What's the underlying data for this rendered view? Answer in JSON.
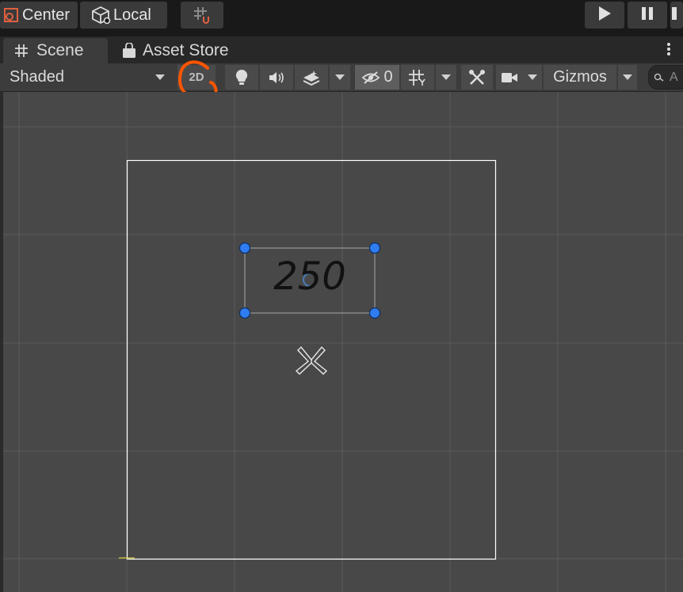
{
  "toolbar": {
    "pivot_label": "Center",
    "rotation_label": "Local",
    "pivot_icon": "pivot-center-icon",
    "rotation_icon": "cube-local-icon",
    "grid_snap_icon": "grid-snap-icon",
    "play_icon": "play-icon",
    "pause_icon": "pause-icon",
    "step_icon": "step-icon"
  },
  "tabs": [
    {
      "label": "Scene",
      "icon": "grid-hash-icon",
      "active": true
    },
    {
      "label": "Asset Store",
      "icon": "shopping-bag-icon",
      "active": false
    }
  ],
  "scene_toolbar": {
    "draw_mode": "Shaded",
    "mode_2d_label": "2D",
    "mode_2d_highlight_color": "#ff5500",
    "lighting_icon": "lightbulb-icon",
    "audio_icon": "speaker-icon",
    "effects_icon": "layers-effects-icon",
    "hidden_icon": "eye-slash-icon",
    "hidden_count": "0",
    "grid_icon": "grid-icon",
    "tools_icon": "tools-icon",
    "camera_icon": "camera-icon",
    "gizmos_label": "Gizmos",
    "search_icon": "search-icon",
    "search_placeholder": "A"
  },
  "scene": {
    "text_object_value": "250",
    "handle_color": "#2f7df0",
    "grid_color": "#5a5a5a",
    "canvas_border_color": "#ffffff",
    "light_icon": "directional-light-icon"
  }
}
